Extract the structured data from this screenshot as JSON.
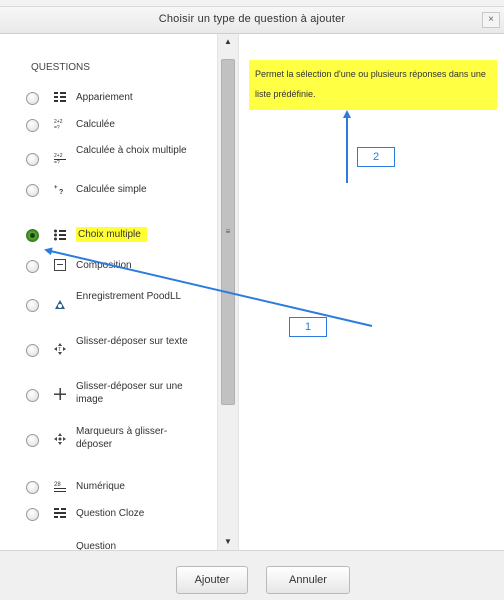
{
  "dialog": {
    "title": "Choisir un type de question à ajouter",
    "close_label": "×"
  },
  "questions": {
    "header": "QUESTIONS",
    "items": [
      {
        "label": "Appariement",
        "icon": "matching-icon",
        "selected": false
      },
      {
        "label": "Calculée",
        "icon": "calculated-icon",
        "selected": false
      },
      {
        "label": "Calculée à choix multiple",
        "icon": "calculated-multichoice-icon",
        "selected": false
      },
      {
        "label": "Calculée simple",
        "icon": "calculated-simple-icon",
        "selected": false
      },
      {
        "label": "Choix multiple",
        "icon": "multichoice-icon",
        "selected": true
      },
      {
        "label": "Composition",
        "icon": "essay-icon",
        "selected": false
      },
      {
        "label": "Enregistrement PoodLL",
        "icon": "poodll-recording-icon",
        "selected": false
      },
      {
        "label": "Glisser-déposer sur texte",
        "icon": "drag-drop-text-icon",
        "selected": false
      },
      {
        "label": "Glisser-déposer sur une image",
        "icon": "drag-drop-image-icon",
        "selected": false
      },
      {
        "label": "Marqueurs à glisser-déposer",
        "icon": "drag-drop-markers-icon",
        "selected": false
      },
      {
        "label": "Numérique",
        "icon": "numerical-icon",
        "selected": false
      },
      {
        "label": "Question Cloze",
        "icon": "cloze-icon",
        "selected": false
      },
      {
        "label": "Question",
        "icon": "",
        "selected": false
      }
    ]
  },
  "description": "Permet la sélection d'une ou plusieurs réponses dans une liste prédéfinie.",
  "callouts": {
    "one": "1",
    "two": "2"
  },
  "buttons": {
    "add": "Ajouter",
    "cancel": "Annuler"
  },
  "colors": {
    "highlight": "#ffff33",
    "annotation_blue": "#2b7cdc",
    "selected_radio": "#58b22f"
  }
}
